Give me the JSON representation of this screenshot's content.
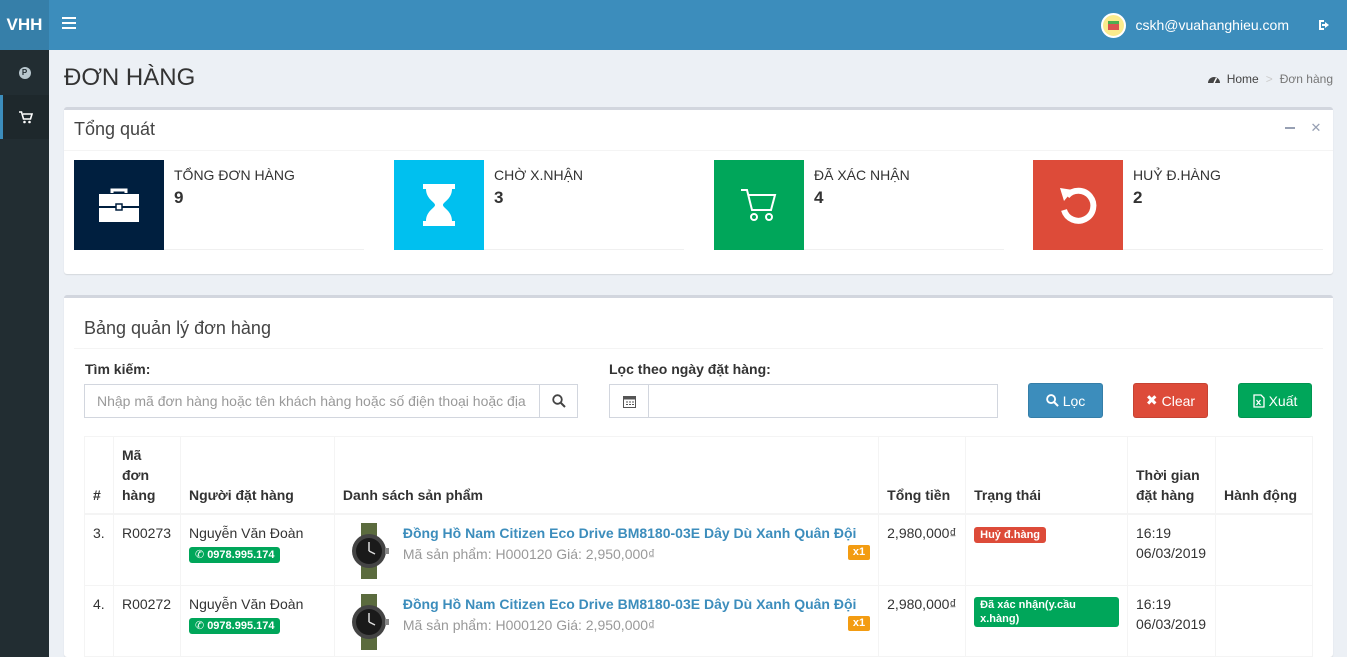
{
  "header": {
    "logo": "VHH",
    "user_email": "cskh@vuahanghieu.com"
  },
  "sidebar": {
    "items": [
      {
        "icon": "coin-icon",
        "active": false
      },
      {
        "icon": "cart-icon",
        "active": true
      }
    ]
  },
  "page": {
    "title": "ĐƠN HÀNG",
    "breadcrumb": {
      "home": "Home",
      "current": "Đơn hàng"
    }
  },
  "overview": {
    "title": "Tổng quát",
    "cards": [
      {
        "label": "TỔNG ĐƠN HÀNG",
        "value": "9",
        "color": "#001f3f",
        "icon": "briefcase-icon"
      },
      {
        "label": "CHỜ X.NHẬN",
        "value": "3",
        "color": "#00c0ef",
        "icon": "hourglass-icon"
      },
      {
        "label": "ĐÃ XÁC NHẬN",
        "value": "4",
        "color": "#00a65a",
        "icon": "cart-icon"
      },
      {
        "label": "HUỶ Đ.HÀNG",
        "value": "2",
        "color": "#dd4b39",
        "icon": "undo-icon"
      }
    ]
  },
  "orders": {
    "title": "Bảng quản lý đơn hàng",
    "search_label": "Tìm kiếm:",
    "search_placeholder": "Nhập mã đơn hàng hoặc tên khách hàng hoặc số điện thoại hoặc địa chỉ",
    "date_label": "Lọc theo ngày đặt hàng:",
    "date_value": "",
    "btn_filter": "Lọc",
    "btn_clear": "Clear",
    "btn_export": "Xuất",
    "columns": {
      "num": "#",
      "code": "Mã đơn hàng",
      "customer": "Người đặt hàng",
      "products": "Danh sách sản phẩm",
      "total": "Tổng tiền",
      "status": "Trạng thái",
      "time": "Thời gian đặt hàng",
      "action": "Hành động"
    },
    "rows": [
      {
        "num": "3.",
        "code": "R00273",
        "customer": "Nguyễn Văn Đoàn",
        "phone": "0978.995.174",
        "product_name": "Đồng Hồ Nam Citizen Eco Drive BM8180-03E Dây Dù Xanh Quân Đội",
        "product_meta": "Mã sản phẩm: H000120 Giá: 2,950,000₫",
        "qty": "x1",
        "total": "2,980,000₫",
        "status": "Huỷ đ.hàng",
        "status_color": "#dd4b39",
        "time": "16:19",
        "date": "06/03/2019"
      },
      {
        "num": "4.",
        "code": "R00272",
        "customer": "Nguyễn Văn Đoàn",
        "phone": "0978.995.174",
        "product_name": "Đồng Hồ Nam Citizen Eco Drive BM8180-03E Dây Dù Xanh Quân Đội",
        "product_meta": "Mã sản phẩm: H000120 Giá: 2,950,000₫",
        "qty": "x1",
        "total": "2,980,000₫",
        "status": "Đã xác nhận(y.cầu x.hàng)",
        "status_color": "#00a65a",
        "time": "16:19",
        "date": "06/03/2019"
      }
    ]
  }
}
